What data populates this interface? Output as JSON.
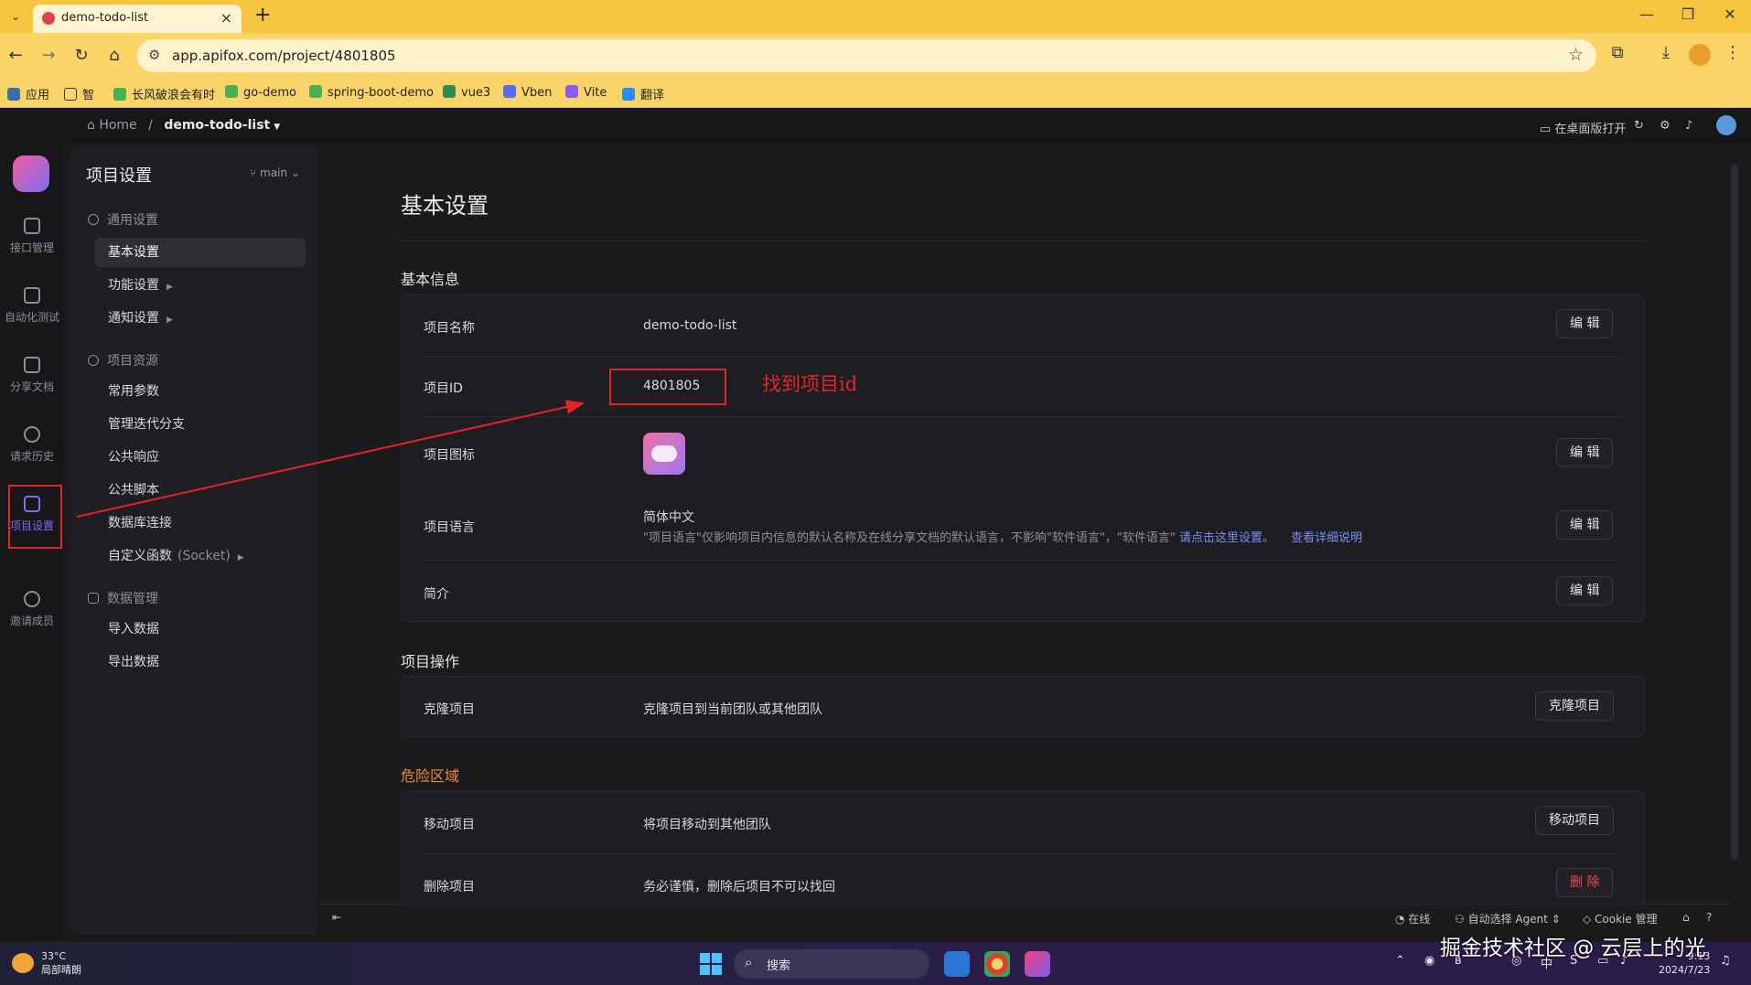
{
  "browser": {
    "tab_title": "demo-todo-list",
    "url": "app.apifox.com/project/4801805",
    "bookmarks": [
      "应用",
      "智",
      "长风破浪会有时",
      "go-demo",
      "spring-boot-demo",
      "vue3",
      "Vben",
      "Vite",
      "翻译"
    ]
  },
  "header": {
    "home": "Home",
    "separator": "/",
    "project": "demo-todo-list",
    "open_desktop": "在桌面版打开"
  },
  "rail": {
    "items": [
      "接口管理",
      "自动化测试",
      "分享文档",
      "请求历史",
      "项目设置",
      "邀请成员"
    ]
  },
  "sidebar": {
    "title": "项目设置",
    "branch": "main",
    "groups": {
      "general": "通用设置",
      "resources": "项目资源",
      "data": "数据管理"
    },
    "items": {
      "basic": "基本设置",
      "feature": "功能设置",
      "notify": "通知设置",
      "params": "常用参数",
      "iteration": "管理迭代分支",
      "response": "公共响应",
      "script": "公共脚本",
      "db": "数据库连接",
      "custom_fn": "自定义函数",
      "custom_fn_hint": "(Socket)",
      "import": "导入数据",
      "export": "导出数据"
    }
  },
  "main": {
    "page_title": "基本设置",
    "basic_info": "基本信息",
    "project_ops": "项目操作",
    "danger_zone": "危险区域",
    "rows": {
      "name_label": "项目名称",
      "name_value": "demo-todo-list",
      "id_label": "项目ID",
      "id_value": "4801805",
      "icon_label": "项目图标",
      "lang_label": "项目语言",
      "lang_value": "简体中文",
      "lang_note": "\"项目语言\"仅影响项目内信息的默认名称及在线分享文档的默认语言，不影响\"软件语言\"，\"软件语言\" ",
      "lang_note_link1": "请点击这里设置。",
      "lang_note_link2": "查看详细说明",
      "intro_label": "简介",
      "clone_label": "克隆项目",
      "clone_desc": "克隆项目到当前团队或其他团队",
      "move_label": "移动项目",
      "move_desc": "将项目移动到其他团队",
      "delete_label": "删除项目",
      "delete_desc": "务必谨慎，删除后项目不可以找回"
    },
    "buttons": {
      "edit": "编 辑",
      "clone": "克隆项目",
      "move": "移动项目",
      "delete": "删 除"
    },
    "annotation": "找到项目id"
  },
  "footer": {
    "online": "在线",
    "agent": "自动选择 Agent",
    "cookie": "Cookie 管理"
  },
  "taskbar": {
    "temp": "33°C",
    "weather": "局部晴朗",
    "search": "搜索",
    "ime": "中",
    "time": "9:13",
    "date": "2024/7/23"
  },
  "watermark": "掘金技术社区 @ 云层上的光",
  "colors": {
    "accent": "#7c6cf2",
    "danger_text": "#f08a3a",
    "delete_red": "#f0474f",
    "annotation_red": "#e3242b",
    "browser_bar": "#f6c43f"
  }
}
